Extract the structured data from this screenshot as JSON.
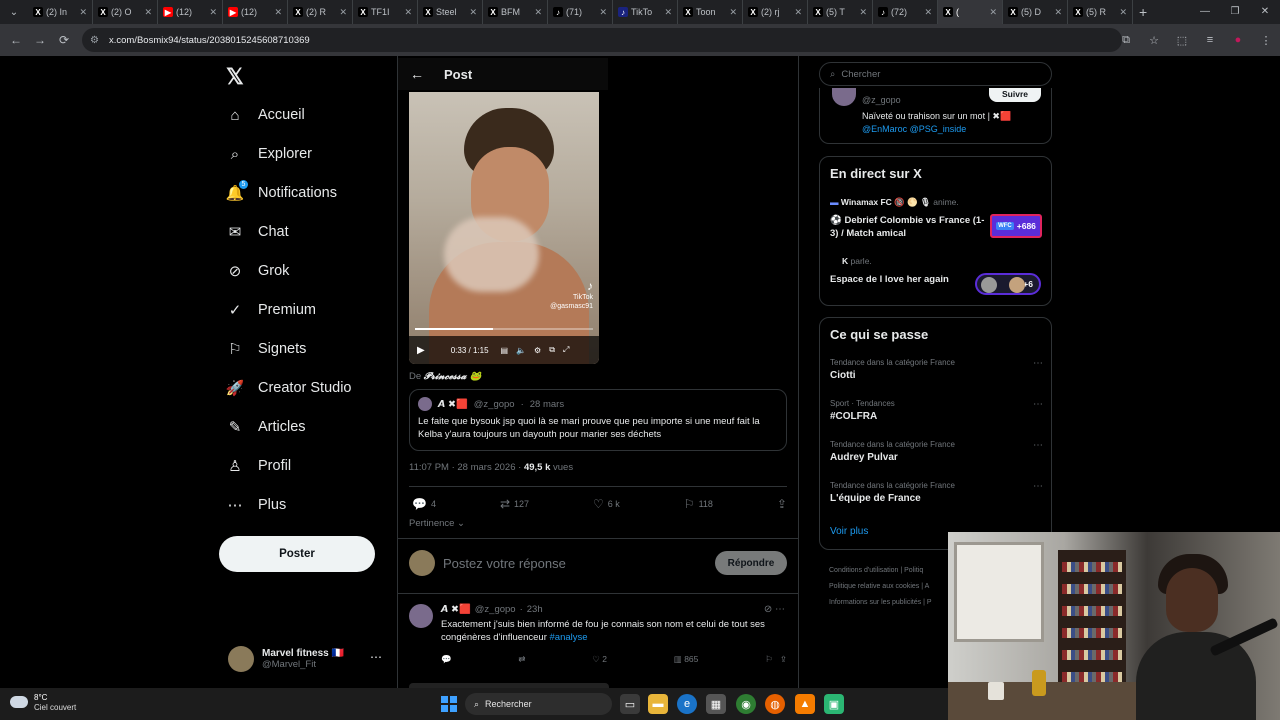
{
  "browser": {
    "tabs": [
      {
        "title": "(2) In",
        "icon": "x-favicon",
        "color": "#000000",
        "glyph": "X",
        "active": false
      },
      {
        "title": "(2) O",
        "icon": "x-favicon",
        "color": "#000000",
        "glyph": "X",
        "active": false
      },
      {
        "title": "(12)",
        "icon": "youtube-favicon",
        "color": "#ff0000",
        "glyph": "▶",
        "active": false
      },
      {
        "title": "(12)",
        "icon": "youtube-favicon",
        "color": "#ff0000",
        "glyph": "▶",
        "active": false
      },
      {
        "title": "(2) R",
        "icon": "x-favicon",
        "color": "#000000",
        "glyph": "X",
        "active": false
      },
      {
        "title": "TF1I",
        "icon": "x-favicon",
        "color": "#000000",
        "glyph": "X",
        "active": false
      },
      {
        "title": "Steel",
        "icon": "x-favicon",
        "color": "#000000",
        "glyph": "X",
        "active": false
      },
      {
        "title": "BFM",
        "icon": "x-favicon",
        "color": "#000000",
        "glyph": "X",
        "active": false
      },
      {
        "title": "(71)",
        "icon": "tiktok-favicon",
        "color": "#000000",
        "glyph": "♪",
        "active": false
      },
      {
        "title": "TikTo",
        "icon": "tiktok-favicon",
        "color": "#1a237e",
        "glyph": "♪",
        "active": false
      },
      {
        "title": "Toon",
        "icon": "x-favicon",
        "color": "#000000",
        "glyph": "X",
        "active": false
      },
      {
        "title": "(2) rj",
        "icon": "x-favicon",
        "color": "#000000",
        "glyph": "X",
        "active": false
      },
      {
        "title": "(5) T",
        "icon": "x-favicon",
        "color": "#000000",
        "glyph": "X",
        "active": false
      },
      {
        "title": "(72)",
        "icon": "tiktok-favicon",
        "color": "#000000",
        "glyph": "♪",
        "active": false
      },
      {
        "title": "(",
        "icon": "x-favicon",
        "color": "#000000",
        "glyph": "X",
        "active": true
      },
      {
        "title": "(5) D",
        "icon": "x-favicon",
        "color": "#000000",
        "glyph": "X",
        "active": false
      },
      {
        "title": "(5) R",
        "icon": "x-favicon",
        "color": "#000000",
        "glyph": "X",
        "active": false
      }
    ],
    "url": "x.com/Bosmix94/status/2038015245608710369"
  },
  "sidebar": {
    "items": [
      {
        "label": "Accueil",
        "icon": "home-icon",
        "glyph": "⌂"
      },
      {
        "label": "Explorer",
        "icon": "search-icon",
        "glyph": "⌕"
      },
      {
        "label": "Notifications",
        "icon": "bell-icon",
        "glyph": "🔔",
        "badge": "5"
      },
      {
        "label": "Chat",
        "icon": "mail-icon",
        "glyph": "✉"
      },
      {
        "label": "Grok",
        "icon": "grok-icon",
        "glyph": "⊘"
      },
      {
        "label": "Premium",
        "icon": "verified-icon",
        "glyph": "✓"
      },
      {
        "label": "Signets",
        "icon": "bookmark-icon",
        "glyph": "⚐"
      },
      {
        "label": "Creator Studio",
        "icon": "rocket-icon",
        "glyph": "🚀"
      },
      {
        "label": "Articles",
        "icon": "article-icon",
        "glyph": "✎"
      },
      {
        "label": "Profil",
        "icon": "person-icon",
        "glyph": "♙"
      },
      {
        "label": "Plus",
        "icon": "more-circle-icon",
        "glyph": "⋯"
      }
    ],
    "post_button": "Poster",
    "account": {
      "name": "Marvel fitness 🇫🇷",
      "handle": "@Marvel_Fit"
    }
  },
  "post": {
    "header_title": "Post",
    "video": {
      "time": "0:33 / 1:15",
      "tiktok_brand": "TikTok",
      "tiktok_handle": "@gasmasc91",
      "progress": 0.44
    },
    "from_label": "De",
    "from_name": "𝓟𝓻𝓲𝓷𝓬𝓮𝓼𝓼𝓪 🐸",
    "quote": {
      "name": "𝘼 ✖🟥",
      "handle": "@z_gopo",
      "time": "28 mars",
      "text": "Le faite que bysouk jsp quoi là se mari prouve que peu importe si une meuf fait la Kelba y'aura toujours un dayouth pour marier ses déchets"
    },
    "timestamp": "11:07 PM · 28 mars 2026 ·",
    "views_count": "49,5 k",
    "views_label": "vues",
    "actions": {
      "replies": "4",
      "reposts": "127",
      "likes": "6 k",
      "bookmarks": "118"
    },
    "sort_label": "Pertinence ⌄",
    "reply_placeholder": "Postez votre réponse",
    "reply_button": "Répondre"
  },
  "reply": {
    "name": "𝘼 ✖🟥",
    "handle": "@z_gopo",
    "time": "23h",
    "text": "Exactement j'suis bien informé de fou je connais son nom et celui de tout ses congénères d'influenceur",
    "hashtag": "#analyse",
    "likes": "2",
    "views": "865"
  },
  "right": {
    "search_placeholder": "Chercher",
    "follow_card": {
      "handle": "@z_gopo",
      "follow_label": "Suivre",
      "text": "Naïveté ou trahison sur un mot | ✖🟥",
      "mentions": "@EnMaroc @PSG_inside"
    },
    "live": {
      "title": "En direct sur X",
      "host1": "Winamax FC 🔞 🌕 🎙",
      "host1_status": "anime.",
      "title1": "⚽ Debrief Colombie vs France (1-3) / Match amical",
      "badge1_logo": "WFC",
      "badge1_count": "+686",
      "host2": "K",
      "host2_status": "parle.",
      "title2": "Espace de l love her again",
      "badge2_count": "+6"
    },
    "trends": {
      "title": "Ce qui se passe",
      "items": [
        {
          "category": "Tendance dans la catégorie France",
          "name": "Ciotti"
        },
        {
          "category": "Sport · Tendances",
          "name": "#COLFRA"
        },
        {
          "category": "Tendance dans la catégorie France",
          "name": "Audrey Pulvar"
        },
        {
          "category": "Tendance dans la catégorie France",
          "name": "L'équipe de France"
        }
      ],
      "more_label": "Voir plus"
    },
    "footer": [
      "Conditions d'utilisation  |  Politiq",
      "Politique relative aux cookies  |  A",
      "Informations sur les publicités  |  P"
    ]
  },
  "taskbar": {
    "temp": "8°C",
    "weather": "Ciel couvert",
    "search": "Rechercher"
  }
}
